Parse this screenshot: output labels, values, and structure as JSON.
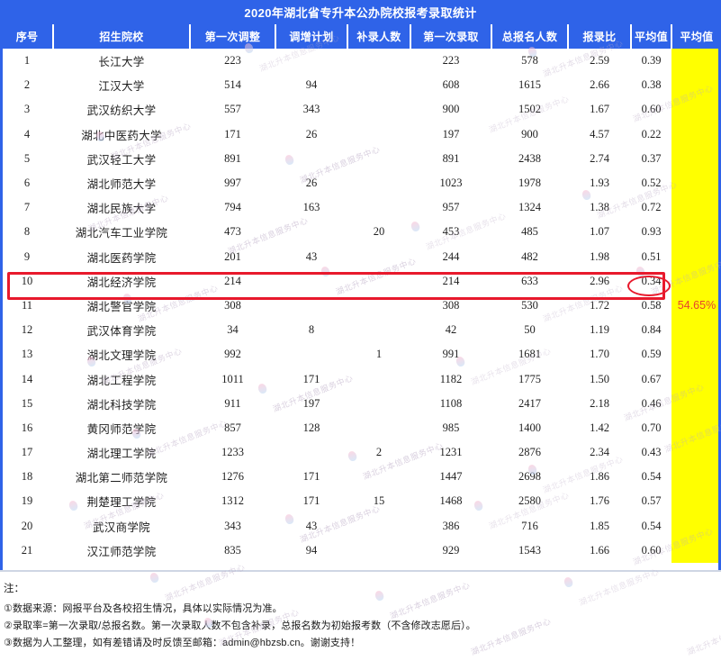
{
  "title": "2020年湖北省专升本公办院校报考录取统计",
  "table": {
    "headers": [
      "序号",
      "招生院校",
      "第一次调整",
      "调增计划",
      "补录人数",
      "第一次录取",
      "总报名人数",
      "报录比",
      "平均值"
    ],
    "rows": [
      {
        "no": "1",
        "school": "长江大学",
        "adjust1": "223",
        "addplan": "",
        "makeup": "",
        "enroll1": "223",
        "applicants": "578",
        "ratio": "2.59",
        "rate": "0.39",
        "avg": ""
      },
      {
        "no": "2",
        "school": "江汉大学",
        "adjust1": "514",
        "addplan": "94",
        "makeup": "",
        "enroll1": "608",
        "applicants": "1615",
        "ratio": "2.66",
        "rate": "0.38",
        "avg": ""
      },
      {
        "no": "3",
        "school": "武汉纺织大学",
        "adjust1": "557",
        "addplan": "343",
        "makeup": "",
        "enroll1": "900",
        "applicants": "1502",
        "ratio": "1.67",
        "rate": "0.60",
        "avg": ""
      },
      {
        "no": "4",
        "school": "湖北中医药大学",
        "adjust1": "171",
        "addplan": "26",
        "makeup": "",
        "enroll1": "197",
        "applicants": "900",
        "ratio": "4.57",
        "rate": "0.22",
        "avg": ""
      },
      {
        "no": "5",
        "school": "武汉轻工大学",
        "adjust1": "891",
        "addplan": "",
        "makeup": "",
        "enroll1": "891",
        "applicants": "2438",
        "ratio": "2.74",
        "rate": "0.37",
        "avg": ""
      },
      {
        "no": "6",
        "school": "湖北师范大学",
        "adjust1": "997",
        "addplan": "26",
        "makeup": "",
        "enroll1": "1023",
        "applicants": "1978",
        "ratio": "1.93",
        "rate": "0.52",
        "avg": ""
      },
      {
        "no": "7",
        "school": "湖北民族大学",
        "adjust1": "794",
        "addplan": "163",
        "makeup": "",
        "enroll1": "957",
        "applicants": "1324",
        "ratio": "1.38",
        "rate": "0.72",
        "avg": ""
      },
      {
        "no": "8",
        "school": "湖北汽车工业学院",
        "adjust1": "473",
        "addplan": "",
        "makeup": "20",
        "enroll1": "453",
        "applicants": "485",
        "ratio": "1.07",
        "rate": "0.93",
        "avg": ""
      },
      {
        "no": "9",
        "school": "湖北医药学院",
        "adjust1": "201",
        "addplan": "43",
        "makeup": "",
        "enroll1": "244",
        "applicants": "482",
        "ratio": "1.98",
        "rate": "0.51",
        "avg": ""
      },
      {
        "no": "10",
        "school": "湖北经济学院",
        "adjust1": "214",
        "addplan": "",
        "makeup": "",
        "enroll1": "214",
        "applicants": "633",
        "ratio": "2.96",
        "rate": "0.34",
        "avg": ""
      },
      {
        "no": "11",
        "school": "湖北警官学院",
        "adjust1": "308",
        "addplan": "",
        "makeup": "",
        "enroll1": "308",
        "applicants": "530",
        "ratio": "1.72",
        "rate": "0.58",
        "avg": "54.65%"
      },
      {
        "no": "12",
        "school": "武汉体育学院",
        "adjust1": "34",
        "addplan": "8",
        "makeup": "",
        "enroll1": "42",
        "applicants": "50",
        "ratio": "1.19",
        "rate": "0.84",
        "avg": ""
      },
      {
        "no": "13",
        "school": "湖北文理学院",
        "adjust1": "992",
        "addplan": "",
        "makeup": "1",
        "enroll1": "991",
        "applicants": "1681",
        "ratio": "1.70",
        "rate": "0.59",
        "avg": ""
      },
      {
        "no": "14",
        "school": "湖北工程学院",
        "adjust1": "1011",
        "addplan": "171",
        "makeup": "",
        "enroll1": "1182",
        "applicants": "1775",
        "ratio": "1.50",
        "rate": "0.67",
        "avg": ""
      },
      {
        "no": "15",
        "school": "湖北科技学院",
        "adjust1": "911",
        "addplan": "197",
        "makeup": "",
        "enroll1": "1108",
        "applicants": "2417",
        "ratio": "2.18",
        "rate": "0.46",
        "avg": ""
      },
      {
        "no": "16",
        "school": "黄冈师范学院",
        "adjust1": "857",
        "addplan": "128",
        "makeup": "",
        "enroll1": "985",
        "applicants": "1400",
        "ratio": "1.42",
        "rate": "0.70",
        "avg": ""
      },
      {
        "no": "17",
        "school": "湖北理工学院",
        "adjust1": "1233",
        "addplan": "",
        "makeup": "2",
        "enroll1": "1231",
        "applicants": "2876",
        "ratio": "2.34",
        "rate": "0.43",
        "avg": ""
      },
      {
        "no": "18",
        "school": "湖北第二师范学院",
        "adjust1": "1276",
        "addplan": "171",
        "makeup": "",
        "enroll1": "1447",
        "applicants": "2698",
        "ratio": "1.86",
        "rate": "0.54",
        "avg": ""
      },
      {
        "no": "19",
        "school": "荆楚理工学院",
        "adjust1": "1312",
        "addplan": "171",
        "makeup": "15",
        "enroll1": "1468",
        "applicants": "2580",
        "ratio": "1.76",
        "rate": "0.57",
        "avg": ""
      },
      {
        "no": "20",
        "school": "武汉商学院",
        "adjust1": "343",
        "addplan": "43",
        "makeup": "",
        "enroll1": "386",
        "applicants": "716",
        "ratio": "1.85",
        "rate": "0.54",
        "avg": ""
      },
      {
        "no": "21",
        "school": "汉江师范学院",
        "adjust1": "835",
        "addplan": "94",
        "makeup": "",
        "enroll1": "929",
        "applicants": "1543",
        "ratio": "1.66",
        "rate": "0.60",
        "avg": ""
      }
    ]
  },
  "annotations": {
    "highlight_row_no": "10",
    "highlight_color": "#e8192c",
    "circled_value": "0.34",
    "average_label": "54.65%"
  },
  "notes": {
    "heading": "注：",
    "lines": [
      "①数据来源：网报平台及各校招生情况，具体以实际情况为准。",
      "②录取率=第一次录取/总报名数。第一次录取人数不包含补录，总报名数为初始报考数（不含修改志愿后）。",
      "③数据为人工整理，如有差错请及时反馈至邮箱：admin@hbzsb.cn。谢谢支持！"
    ]
  },
  "watermark": {
    "text": "湖北升本信息服务中心"
  },
  "colors": {
    "header_blue": "#2f63e8",
    "average_yellow": "#ffff00",
    "average_text": "#e8442c",
    "annotation_red": "#e8192c"
  }
}
